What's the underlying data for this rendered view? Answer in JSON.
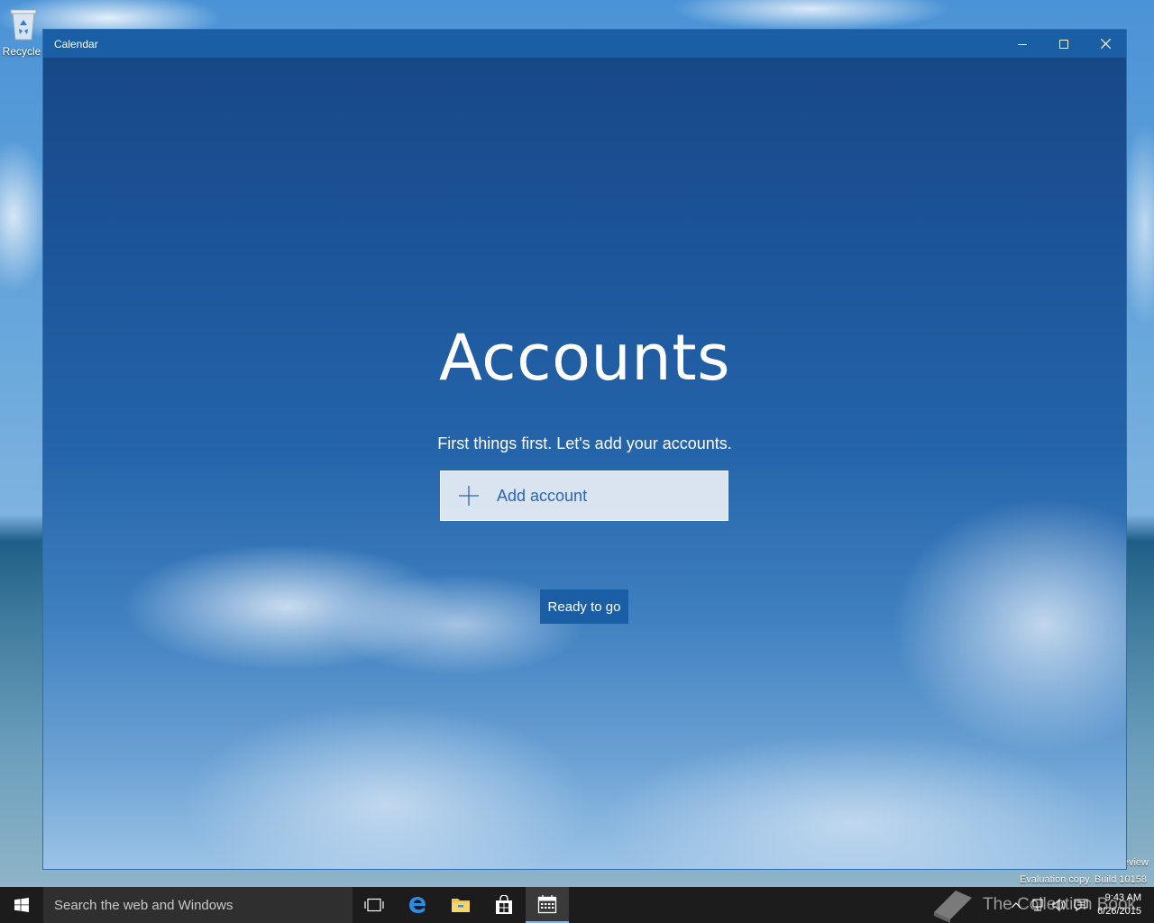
{
  "desktop": {
    "icons": [
      {
        "label": "Recycle",
        "icon": "recycle-bin-icon"
      }
    ],
    "watermark": {
      "line1": "eview",
      "line2": "Evaluation copy. Build 10158"
    }
  },
  "window": {
    "title": "Calendar",
    "controls": {
      "minimize": "minimize-icon",
      "maximize": "maximize-icon",
      "close": "close-icon"
    }
  },
  "accounts_page": {
    "heading": "Accounts",
    "subheading": "First things first. Let's add your accounts.",
    "add_account_label": "Add account",
    "add_account_icon": "plus-icon",
    "ready_button_label": "Ready to go"
  },
  "taskbar": {
    "start_icon": "windows-start-icon",
    "search_placeholder": "Search the web and Windows",
    "pinned": [
      {
        "name": "task-view-icon"
      },
      {
        "name": "edge-icon"
      },
      {
        "name": "file-explorer-icon"
      },
      {
        "name": "store-icon"
      },
      {
        "name": "calendar-icon",
        "active": true
      }
    ],
    "brand_text": "The Collection Book",
    "clock": {
      "time": "9:43 AM",
      "date": "6/26/2015"
    }
  },
  "colors": {
    "titlebar": "#1a5fa6",
    "accent": "#2a66b7",
    "taskbar": "#1c1c1c"
  }
}
